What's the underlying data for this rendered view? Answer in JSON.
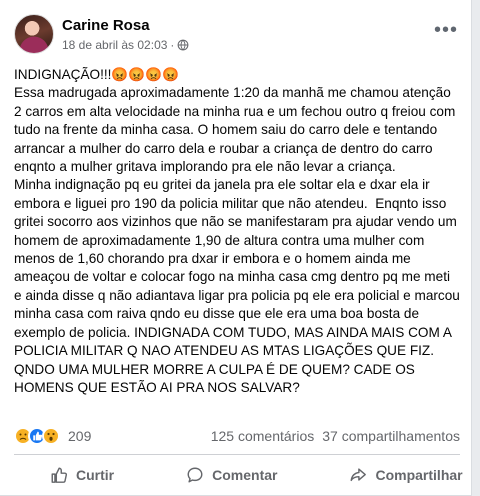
{
  "author": {
    "name": "Carine Rosa",
    "timestamp": "18 de abril às 02:03",
    "separator": "·",
    "audience_icon": "globe-icon"
  },
  "menu_icon": "more-dots-icon",
  "post": {
    "text": "INDIGNAÇÃO!!!😡😡😡😡\nEssa madrugada aproximadamente 1:20 da manhã me chamou atenção 2 carros em alta velocidade na minha rua e um fechou outro q freiou com tudo na frente da minha casa. O homem saiu do carro dele e tentando arrancar a mulher do carro dela e roubar a criança de dentro do carro enqnto a mulher gritava implorando pra ele não levar a criança.\nMinha indignação pq eu gritei da janela pra ele soltar ela e dxar ela ir embora e liguei pro 190 da policia militar que não atendeu.  Enqnto isso gritei socorro aos vizinhos que não se manifestaram pra ajudar vendo um homem de aproximadamente 1,90 de altura contra uma mulher com menos de 1,60 chorando pra dxar ir embora e o homem ainda me ameaçou de voltar e colocar fogo na minha casa cmg dentro pq me meti e ainda disse q não adiantava ligar pra policia pq ele era policial e marcou minha casa com raiva qndo eu disse que ele era uma boa bosta de exemplo de policia. INDIGNADA COM TUDO, MAS AINDA MAIS COM A POLICIA MILITAR Q NAO ATENDEU AS MTAS LIGAÇÕES QUE FIZ. QNDO UMA MULHER MORRE A CULPA É DE QUEM? CADE OS HOMENS QUE ESTÃO AI PRA NOS SALVAR?"
  },
  "stats": {
    "reactions_count": "209",
    "comments": "125 comentários",
    "shares": "37 compartilhamentos",
    "reaction_icons": [
      "sad-reaction-icon",
      "like-reaction-icon",
      "wow-reaction-icon"
    ]
  },
  "actions": {
    "like": "Curtir",
    "comment": "Comentar",
    "share": "Compartilhar"
  },
  "colors": {
    "secondary_text": "#65676b",
    "like_blue": "#1877f2",
    "reaction_yellow": "#f7b125"
  }
}
